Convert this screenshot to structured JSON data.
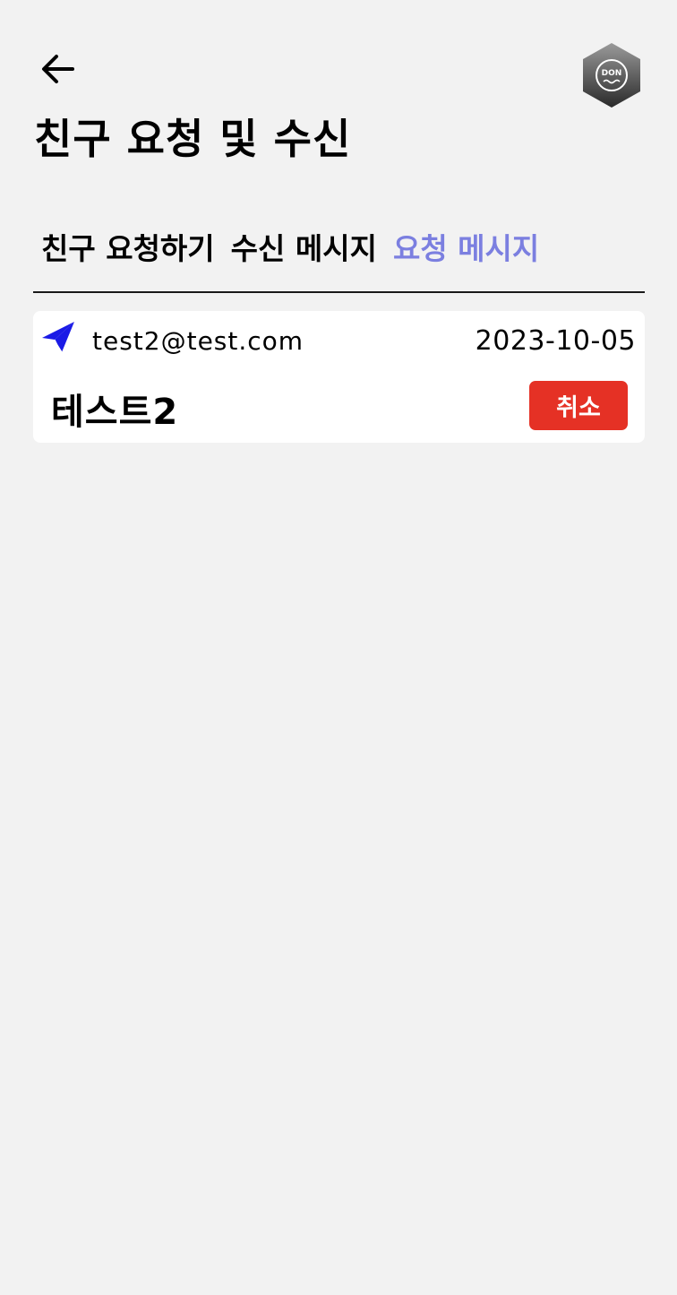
{
  "header": {
    "title": "친구 요청 및 수신",
    "back_icon": "arrow-left-icon",
    "logo_text": "DON"
  },
  "tabs": [
    {
      "label": "친구 요청하기",
      "active": false
    },
    {
      "label": "수신 메시지",
      "active": false
    },
    {
      "label": "요청 메시지",
      "active": true
    }
  ],
  "requests": [
    {
      "icon": "paper-plane-icon",
      "email": "test2@test.com",
      "date": "2023-10-05",
      "name": "테스트2",
      "cancel_label": "취소"
    }
  ],
  "colors": {
    "background": "#f2f2f2",
    "active_tab": "#7b7fe0",
    "cancel_button": "#e53125",
    "send_icon": "#1a1ae6"
  }
}
